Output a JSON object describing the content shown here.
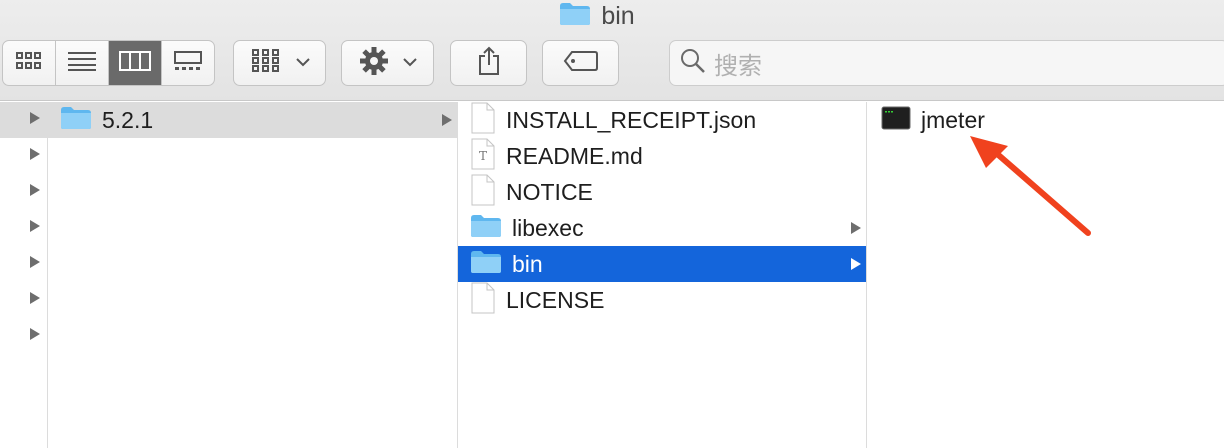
{
  "window": {
    "title": "bin"
  },
  "toolbar": {
    "search": {
      "placeholder": "搜索"
    }
  },
  "columns": {
    "col2": [
      {
        "label": "5.2.1",
        "type": "folder",
        "selected": true
      }
    ],
    "col3": [
      {
        "label": "INSTALL_RECEIPT.json",
        "type": "file"
      },
      {
        "label": "README.md",
        "type": "text-file"
      },
      {
        "label": "NOTICE",
        "type": "file"
      },
      {
        "label": "libexec",
        "type": "folder"
      },
      {
        "label": "bin",
        "type": "folder",
        "selected": true
      },
      {
        "label": "LICENSE",
        "type": "file"
      }
    ],
    "col4": [
      {
        "label": "jmeter",
        "type": "executable"
      }
    ]
  },
  "colors": {
    "selection_blue": "#1465db",
    "folder_blue": "#6cc0f4",
    "annotation_arrow": "#f0421e"
  }
}
